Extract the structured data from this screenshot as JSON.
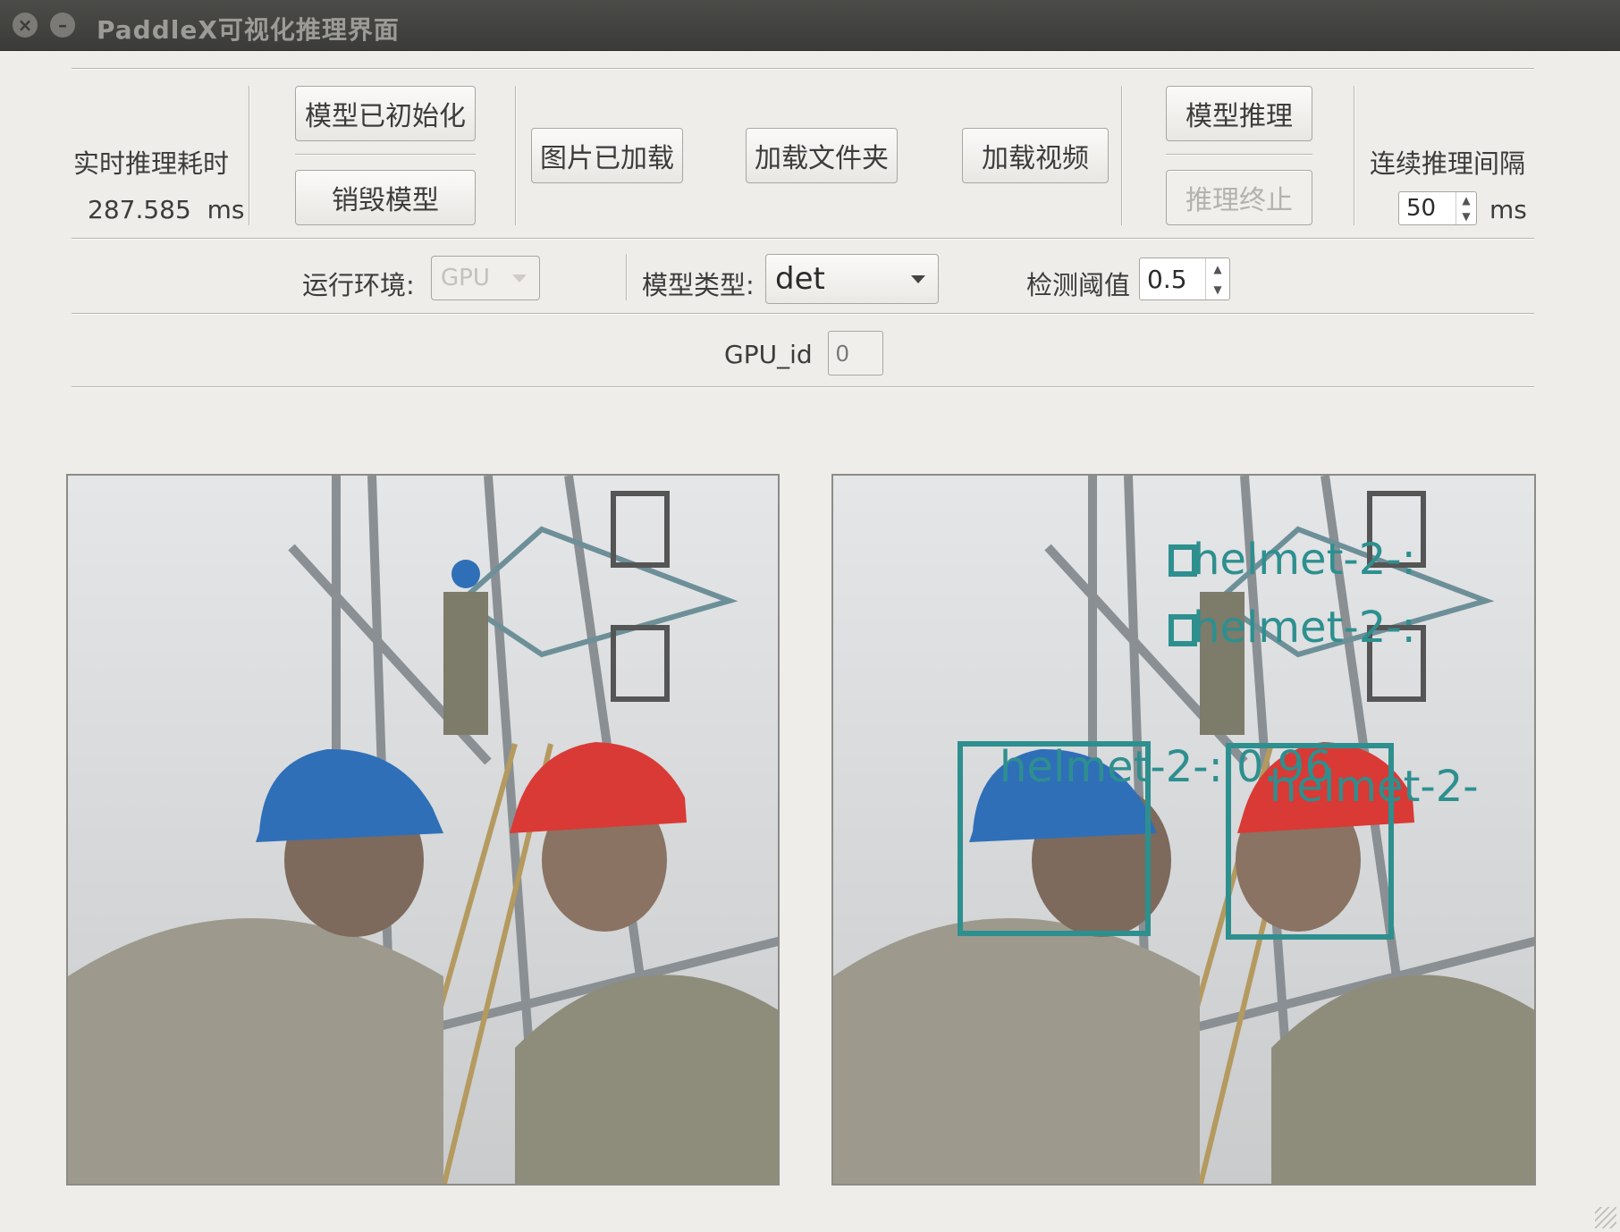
{
  "window": {
    "title": "PaddleX可视化推理界面"
  },
  "timing": {
    "label": "实时推理耗时",
    "value": "287.585",
    "unit": "ms"
  },
  "buttons": {
    "model_init": "模型已初始化",
    "destroy_model": "销毁模型",
    "image_loaded": "图片已加载",
    "load_folder": "加载文件夹",
    "load_video": "加载视频",
    "model_infer": "模型推理",
    "infer_stop": "推理终止"
  },
  "interval": {
    "label": "连续推理间隔",
    "value": "50",
    "unit": "ms"
  },
  "env": {
    "label": "运行环境:",
    "value": "GPU"
  },
  "model_type": {
    "label": "模型类型:",
    "value": "det"
  },
  "threshold": {
    "label": "检测阈值",
    "value": "0.5"
  },
  "gpu": {
    "label": "GPU_id",
    "placeholder": "0"
  },
  "detections": [
    {
      "label": "helmet-2-:",
      "box_color": "#2e8f8f"
    },
    {
      "label": "helmet-2-:",
      "box_color": "#2e8f8f"
    },
    {
      "label": "helmet-2-: 0.96",
      "box_color": "#2e8f8f"
    },
    {
      "label": "helmet-2-",
      "box_color": "#2e8f8f"
    }
  ],
  "colors": {
    "detection": "#2e8f8f",
    "helmet_blue": "#2f6fb8",
    "helmet_red": "#d93a35"
  }
}
